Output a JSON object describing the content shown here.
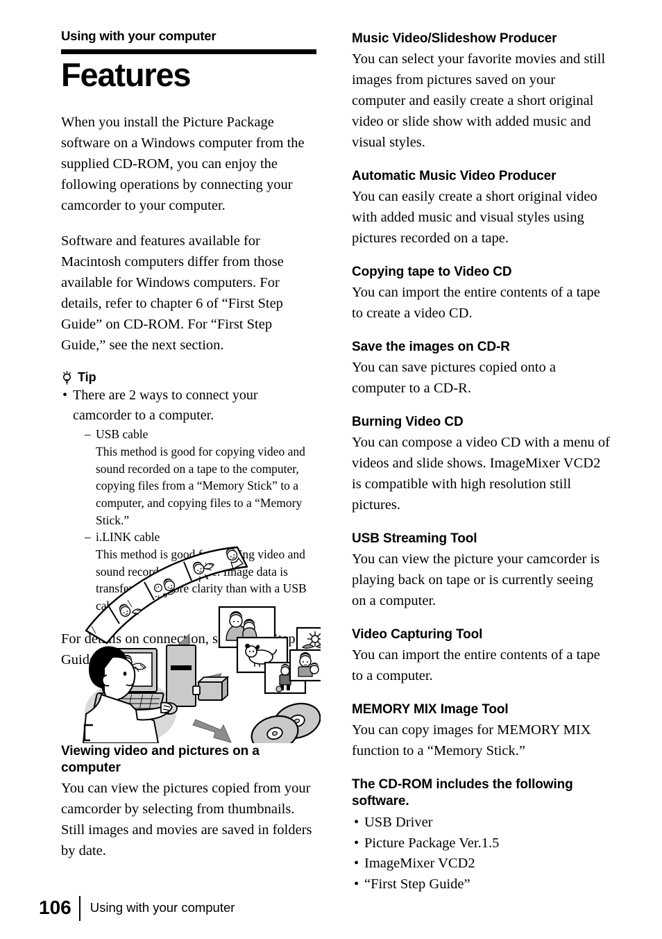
{
  "header": {
    "chapter_label": "Using with your computer",
    "title": "Features"
  },
  "left_column": {
    "intro_paragraph_1": "When you install the Picture Package software on a Windows computer from the supplied CD-ROM, you can enjoy the following operations by connecting your camcorder to your computer.",
    "intro_paragraph_2": "Software and features available for Macintosh computers differ from those available for Windows computers. For details, refer to chapter 6 of “First Step Guide” on CD-ROM. For “First Step Guide,” see the next section.",
    "tip": {
      "icon": "lightbulb-icon",
      "label": "Tip",
      "bullet": "There are 2 ways to connect your camcorder to a computer.",
      "items": [
        {
          "term": "USB cable",
          "description": "This method is good for copying video and sound recorded on a tape to the computer, copying files from a “Memory Stick” to a computer, and copying files to a “Memory Stick.”"
        },
        {
          "term": "i.LINK cable",
          "description": "This method is good for copying video and sound recorded on a tape. Image data is transferred in more clarity than with a USB cable."
        }
      ]
    },
    "connection_paragraph": "For details on connection, see “First Step Guide.”",
    "figure": {
      "name": "computer-workflow-illustration",
      "description": "Person at a computer with film strip, photo thumbnails and CDs"
    },
    "closing_section": {
      "heading": "Viewing video and pictures on a computer",
      "body": "You can view the pictures copied from your camcorder by selecting from thumbnails. Still images and movies are saved in folders by date."
    }
  },
  "right_column": {
    "sections": [
      {
        "heading": "Music Video/Slideshow Producer",
        "body": "You can select your favorite movies and still images from pictures saved on your computer and easily create a short original video or slide show with added music and visual styles."
      },
      {
        "heading": "Automatic Music Video Producer",
        "body": "You can easily create a short original video with added music and visual styles using pictures recorded on a tape."
      },
      {
        "heading": "Copying tape to Video CD",
        "body": "You can import the entire contents of a tape to create a video CD."
      },
      {
        "heading": "Save the images on CD-R",
        "body": "You can save pictures copied onto a computer to a CD-R."
      },
      {
        "heading": "Burning Video CD",
        "body": "You can compose a video CD with a menu of videos and slide shows. ImageMixer VCD2 is compatible with high resolution still pictures."
      },
      {
        "heading": "USB Streaming Tool",
        "body": "You can view the picture your camcorder is playing back on tape or is currently seeing on a computer."
      },
      {
        "heading": "Video Capturing Tool",
        "body": "You can import the entire contents of a tape to a computer."
      },
      {
        "heading": "MEMORY MIX Image Tool",
        "body": "You can copy images for MEMORY MIX function to a “Memory Stick.”"
      }
    ],
    "software_section": {
      "heading": "The CD-ROM includes the following software.",
      "items": [
        "USB Driver",
        "Picture Package Ver.1.5",
        "ImageMixer VCD2",
        "“First Step Guide”"
      ]
    }
  },
  "footer": {
    "page_number": "106",
    "running_title": "Using with your computer"
  }
}
